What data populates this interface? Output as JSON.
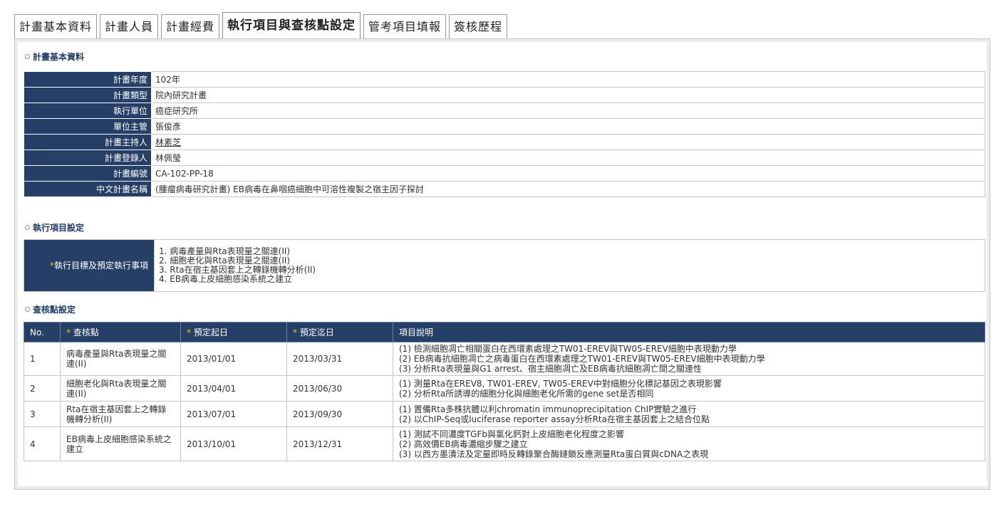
{
  "tabs": [
    {
      "label": "計畫基本資料"
    },
    {
      "label": "計畫人員"
    },
    {
      "label": "計畫經費"
    },
    {
      "label": "執行項目與查核點設定"
    },
    {
      "label": "管考項目填報"
    },
    {
      "label": "簽核歷程"
    }
  ],
  "basic": {
    "title": "計畫基本資料",
    "rows": [
      {
        "label": "計畫年度",
        "value": "102年"
      },
      {
        "label": "計畫類型",
        "value": "院內研究計畫"
      },
      {
        "label": "執行單位",
        "value": "癌症研究所"
      },
      {
        "label": "單位主管",
        "value": "張俊彥"
      },
      {
        "label": "計畫主持人",
        "value": "林素芝"
      },
      {
        "label": "計畫登錄人",
        "value": "林佩瑩"
      },
      {
        "label": "計畫編號",
        "value": "CA-102-PP-18"
      },
      {
        "label": "中文計畫名稱",
        "value": "(腫瘤病毒研究計畫) EB病毒在鼻咽癌細胞中可溶性複製之宿主因子探討"
      }
    ]
  },
  "exec": {
    "title": "執行項目設定",
    "star": "*",
    "label": "執行目標及預定執行事項",
    "items": [
      "1. 病毒產量與Rta表現量之關連(II)",
      "2. 細胞老化與Rta表現量之關連(II)",
      "3. Rta在宿主基因套上之轉錄機轉分析(II)",
      "4. EB病毒上皮細胞感染系統之建立"
    ]
  },
  "checkpoints": {
    "title": "查核點設定",
    "headers": {
      "no": "No.",
      "point": "查核點",
      "start": "預定起日",
      "end": "預定迄日",
      "desc": "項目說明"
    },
    "rows": [
      {
        "no": "1",
        "point": "病毒產量與Rta表現量之關連(II)",
        "start": "2013/01/01",
        "end": "2013/03/31",
        "desc": [
          "(1) 檢測細胞凋亡相關蛋白在西環素處理之TW01-EREV與TW05-EREV細胞中表現動力學",
          "(2) EB病毒抗細胞凋亡之病毒蛋白在西環素處理之TW01-EREV與TW05-EREV細胞中表現動力學",
          "(3) 分析Rta表現量與G1 arrest、宿主細胞凋亡及EB病毒抗細胞凋亡間之關連性"
        ]
      },
      {
        "no": "2",
        "point": "細胞老化與Rta表現量之關連(II)",
        "start": "2013/04/01",
        "end": "2013/06/30",
        "desc": [
          "(1) 測量Rta在EREV8, TW01-EREV, TW05-EREV中對細胞分化標記基因之表現影響",
          "(2) 分析Rta所誘導的細胞分化與細胞老化所需的gene set是否相同"
        ]
      },
      {
        "no": "3",
        "point": "Rta在宿主基因套上之轉錄機轉分析(II)",
        "start": "2013/07/01",
        "end": "2013/09/30",
        "desc": [
          "(1) 置備Rta多株抗體以利chromatin immunoprecipitation ChIP實驗之進行",
          "(2) 以ChIP-Seq或luciferase reporter assay分析Rta在宿主基因套上之結合位點"
        ]
      },
      {
        "no": "4",
        "point": "EB病毒上皮細胞感染系統之建立",
        "start": "2013/10/01",
        "end": "2013/12/31",
        "desc": [
          "(1) 測試不同濃度TGFb與氯化鈣對上皮細胞老化程度之影響",
          "(2) 高效價EB病毒濃縮步驟之建立",
          "(3) 以西方墨漬法及定量即時反轉錄聚合酶鏈鎖反應測量Rta蛋白質與cDNA之表現"
        ]
      }
    ]
  },
  "colors": {
    "header_bg": "#253f66",
    "star": "#f0c400",
    "panel_bg": "#e8edf2"
  }
}
